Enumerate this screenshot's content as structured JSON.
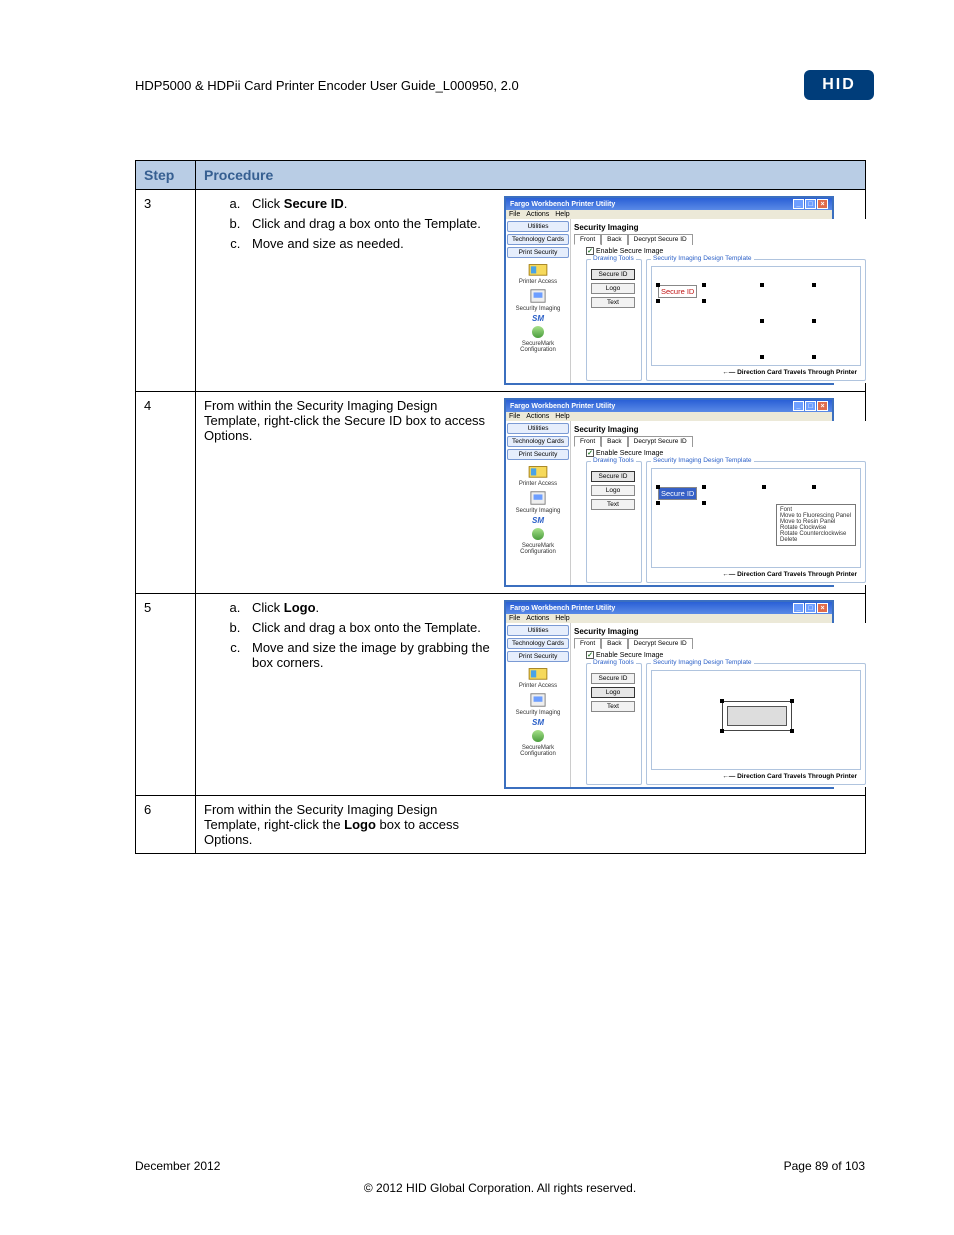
{
  "doc": {
    "title": "HDP5000 & HDPii Card Printer Encoder User Guide_L000950, 2.0",
    "logo_text": "HID",
    "footer_date": "December 2012",
    "footer_page": "Page 89 of 103",
    "copyright": "© 2012 HID Global Corporation. All rights reserved."
  },
  "table": {
    "head_step": "Step",
    "head_proc": "Procedure"
  },
  "rows": [
    {
      "step": "3",
      "letters": [
        {
          "pref": "Click ",
          "bold": "Secure ID",
          "suf": "."
        },
        {
          "plain": "Click and drag a box onto the Template."
        },
        {
          "plain": "Move and size as needed."
        }
      ],
      "shot": {
        "mode": "secure_id"
      }
    },
    {
      "step": "4",
      "plain": "From within the Security Imaging Design Template, right-click the Secure ID box to access Options.",
      "shot": {
        "mode": "secure_id_ctx"
      }
    },
    {
      "step": "5",
      "letters": [
        {
          "pref": "Click ",
          "bold": "Logo",
          "suf": "."
        },
        {
          "plain": "Click and drag a box onto the Template."
        },
        {
          "plain": "Move and size the image by grabbing the box corners."
        }
      ],
      "shot": {
        "mode": "logo"
      }
    },
    {
      "step": "6",
      "rich": {
        "pref": "From within the Security Imaging Design Template, right-click the ",
        "bold": "Logo",
        "suf": " box to access Options."
      },
      "shot": null
    }
  ],
  "app": {
    "title": "Fargo Workbench Printer Utility",
    "menus": [
      "File",
      "Actions",
      "Help"
    ],
    "nav": {
      "utilities": "Utilities",
      "techcards": "Technology Cards",
      "printsec": "Print Security",
      "printeraccess": "Printer Access",
      "secimg": "Security Imaging",
      "sm": "SM",
      "smcfg": "SecureMark Configuration"
    },
    "heading": "Security Imaging",
    "tabs": {
      "front": "Front",
      "back": "Back",
      "decrypt": "Decrypt Secure ID"
    },
    "enable": "Enable Secure Image",
    "drawing": "Drawing Tools",
    "template": "Security Imaging Design Template",
    "tools": {
      "secureid": "Secure ID",
      "logo": "Logo",
      "text": "Text"
    },
    "sid_label": "Secure ID",
    "direction": "Direction Card Travels Through Printer",
    "ctx_items": [
      "Font",
      "Move to Fluorescing Panel",
      "Move to Resin Panel",
      "Rotate Clockwise",
      "Rotate Counterclockwise",
      "Delete"
    ]
  }
}
